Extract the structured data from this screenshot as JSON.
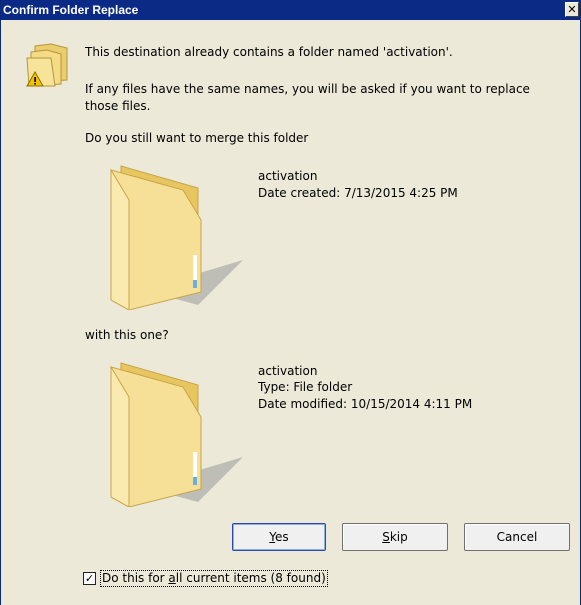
{
  "window": {
    "title": "Confirm Folder Replace",
    "close_glyph": "✕"
  },
  "message": {
    "line1": "This destination already contains a folder named 'activation'.",
    "line2a": "If any files have the same names, you will be asked if you want to replace",
    "line2b": "those files.",
    "question": "Do you still want to merge this folder",
    "with_this": "with this one?"
  },
  "source_folder": {
    "name": "activation",
    "date_created": "Date created: 7/13/2015 4:25 PM"
  },
  "target_folder": {
    "name": "activation",
    "type": "Type: File folder",
    "date_modified": "Date modified: 10/15/2014 4:11 PM"
  },
  "buttons": {
    "yes_mnemonic": "Y",
    "yes_rest": "es",
    "skip_mnemonic": "S",
    "skip_rest": "kip",
    "cancel": "Cancel"
  },
  "apply_all": {
    "checked": true,
    "prefix": "Do this for ",
    "mnemonic": "a",
    "suffix": "ll current items (8 found)"
  },
  "icons": [
    "warning-folder-icon",
    "folder-icon",
    "close-icon",
    "checkbox-check-icon"
  ],
  "colors": {
    "titlebar": "#0b2a86",
    "dialog_bg": "#ece9d8",
    "folder": "#f3dd85"
  }
}
